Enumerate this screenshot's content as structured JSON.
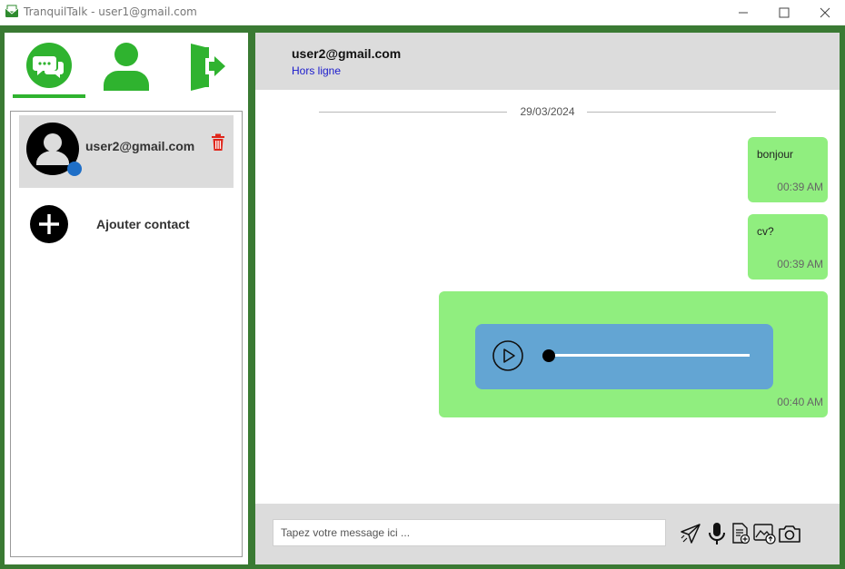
{
  "window": {
    "title": "TranquilTalk - user1@gmail.com",
    "controls": {
      "minimize": "minimize",
      "maximize": "maximize",
      "close": "close"
    }
  },
  "theme": {
    "frame": "#3a7a33",
    "accent": "#2fb32f",
    "bubble": "#90ee7f",
    "audio": "#63a5d3",
    "danger": "#e0261b",
    "status": "#1a1acc"
  },
  "nav": {
    "tabs": [
      {
        "name": "chats",
        "icon": "chat-bubbles-icon",
        "active": true
      },
      {
        "name": "profile",
        "icon": "user-icon",
        "active": false
      },
      {
        "name": "logout",
        "icon": "logout-door-icon",
        "active": false
      }
    ]
  },
  "contacts": {
    "items": [
      {
        "email": "user2@gmail.com",
        "avatar_icon": "default-avatar-icon",
        "presence_icon": "presence-dot-icon",
        "delete_icon": "trash-icon"
      }
    ],
    "add_label": "Ajouter contact"
  },
  "chat": {
    "peer_name": "user2@gmail.com",
    "peer_status": "Hors ligne",
    "date": "29/03/2024",
    "messages": [
      {
        "type": "text",
        "text": "bonjour",
        "time": "00:39 AM"
      },
      {
        "type": "text",
        "text": "cv?",
        "time": "00:39 AM"
      },
      {
        "type": "audio",
        "time": "00:40 AM",
        "progress": 0
      }
    ]
  },
  "composer": {
    "placeholder": "Tapez votre message ici ...",
    "value": "",
    "tools": [
      "send-icon",
      "microphone-icon",
      "document-icon",
      "image-upload-icon",
      "camera-icon"
    ]
  }
}
